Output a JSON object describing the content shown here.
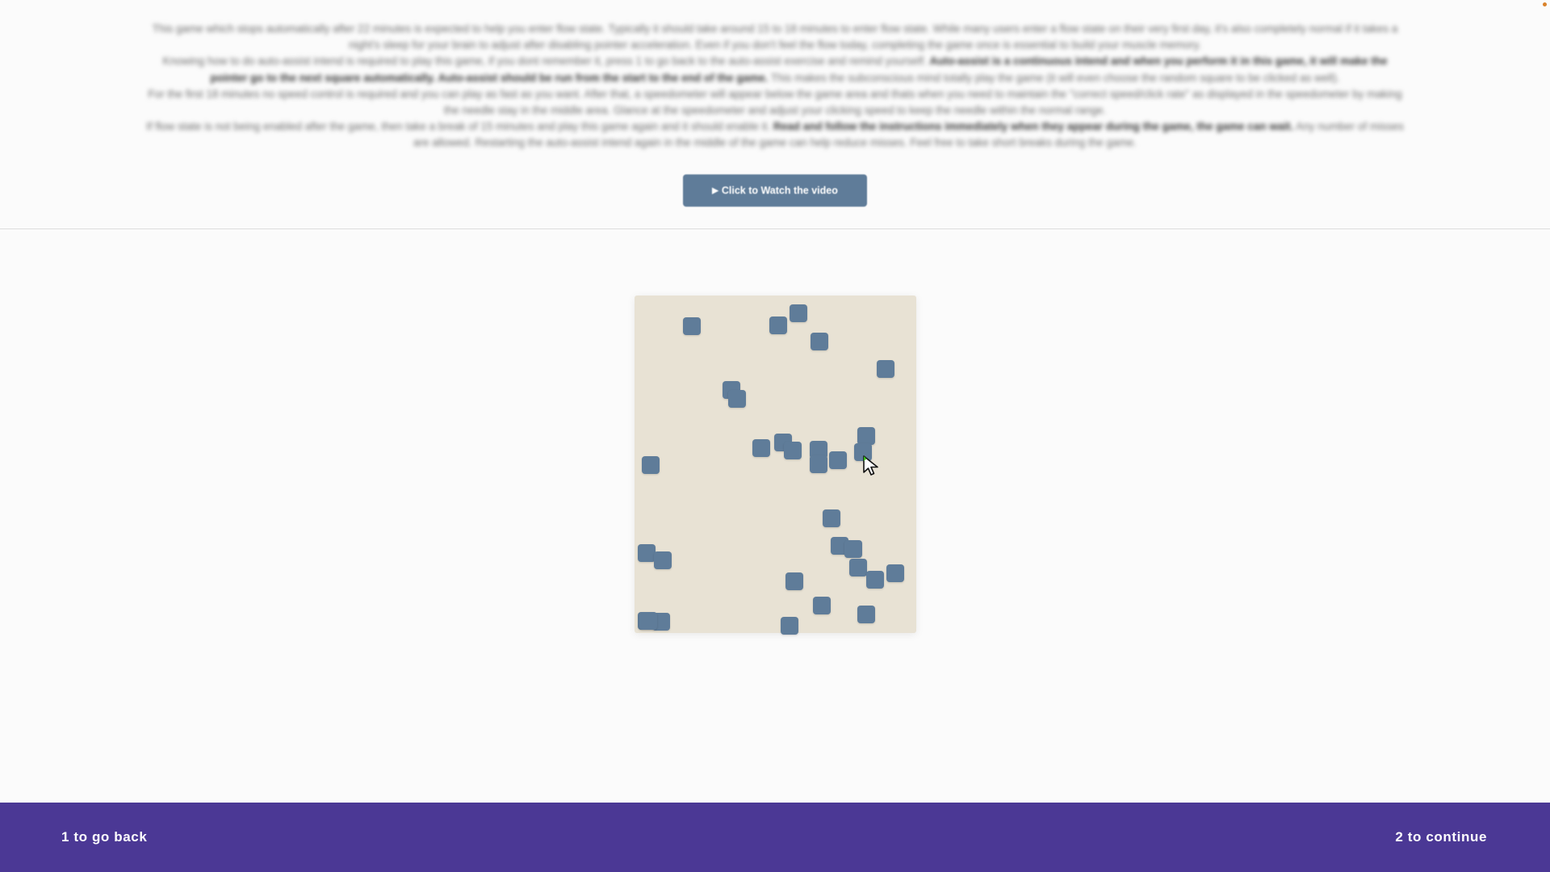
{
  "instructions": {
    "p1": "This game which stops automatically after 22 minutes is expected to help you enter flow state. Typically it should take around 15 to 18 minutes to enter flow state. While many users enter a flow state on their very first day, it's also completely normal if it takes a night's sleep for your brain to adjust after disabling pointer acceleration. Even if you don't feel the flow today, completing the game once is essential to build your muscle memory.",
    "p2_start": "Knowing how to do auto-assist intend is required to play this game, if you dont remember it, press 1 to go back to the auto-assist exercise and remind yourself. ",
    "p2_bold": "Auto-assist is a continuous intend and when you perform it in this game, it will make the pointer go to the next square automatically. Auto-assist should be run from the start to the end of the game.",
    "p2_end": " This makes the subconscious mind totally play the game (it will even choose the random square to be clicked as well).",
    "p3": "For the first 18 minutes no speed control is required and you can play as fast as you want. After that, a speedometer will appear below the game area and thats when you need to maintain the \"correct speed/click rate\" as displayed in the speedometer by making the needle stay in the middle area. Glance at the speedometer and adjust your clicking speed to keep the needle within the normal range.",
    "p4_start": "If flow state is not being enabled after the game, then take a break of 15 minutes and play this game again and it should enable it. ",
    "p4_bold": "Read and follow the instructions immediately when they appear during the game, the game can wait.",
    "p4_end": " Any number of misses are allowed. Restarting the auto-assist intend again in the middle of the game can help reduce misses. Feel free to take short breaks during the game."
  },
  "video_button": {
    "icon": "play-icon",
    "label": "Click to Watch the video"
  },
  "game": {
    "square_color": "#5f7c99",
    "background_color": "#e8e2d4",
    "square_count": 31
  },
  "footer": {
    "color": "#4b3895",
    "back_label": "1 to go back",
    "continue_label": "2 to continue"
  }
}
